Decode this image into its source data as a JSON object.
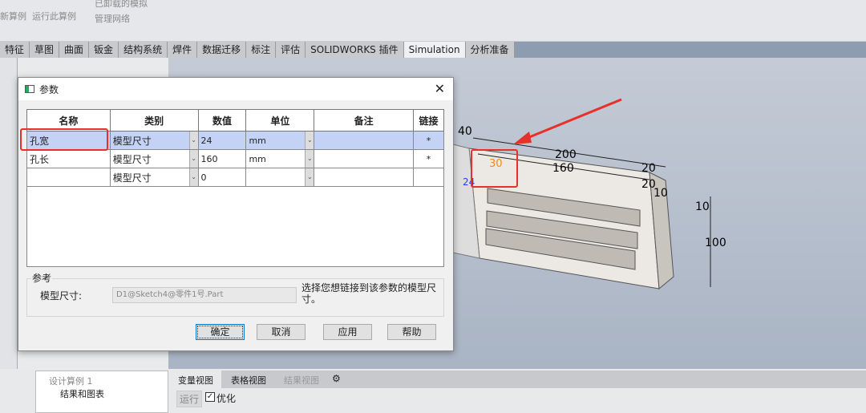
{
  "ribbon": {
    "new_study": "新算例",
    "run_study": "运行此算例",
    "unloaded_sims": "已卸载的模拟",
    "manage_network": "管理网络"
  },
  "tabs": [
    "特征",
    "草图",
    "曲面",
    "钣金",
    "结构系统",
    "焊件",
    "数据迁移",
    "标注",
    "评估",
    "SOLIDWORKS 插件",
    "Simulation",
    "分析准备"
  ],
  "active_tab": "Simulation",
  "dialog": {
    "title": "参数",
    "columns": [
      "名称",
      "类别",
      "数值",
      "单位",
      "备注",
      "链接"
    ],
    "rows": [
      {
        "name": "孔宽",
        "category": "模型尺寸",
        "value": "24",
        "unit": "mm",
        "note": "",
        "link": "*",
        "selected": true
      },
      {
        "name": "孔长",
        "category": "模型尺寸",
        "value": "160",
        "unit": "mm",
        "note": "",
        "link": "*"
      },
      {
        "name": "",
        "category": "模型尺寸",
        "value": "0",
        "unit": "",
        "note": "",
        "link": ""
      }
    ],
    "reference": {
      "group": "参考",
      "label": "模型尺寸:",
      "value": "D1@Sketch4@零件1号.Part",
      "hint": "选择您想链接到该参数的模型尺寸。"
    },
    "buttons": {
      "ok": "确定",
      "cancel": "取消",
      "apply": "应用",
      "help": "帮助"
    }
  },
  "model": {
    "dims": [
      "40",
      "200",
      "160",
      "20",
      "20",
      "10",
      "10",
      "100",
      "30",
      "24"
    ]
  },
  "bottom": {
    "tree_root": "设计算例 1",
    "tree_child": "结果和图表",
    "tabs": [
      "变量视图",
      "表格视图",
      "结果视图"
    ],
    "run": "运行",
    "optimize": "优化",
    "optimize_checked": true
  },
  "colors": {
    "highlight": "#e8302a",
    "selection": "#c4d3f5",
    "dim_orange": "#f08a1c"
  }
}
